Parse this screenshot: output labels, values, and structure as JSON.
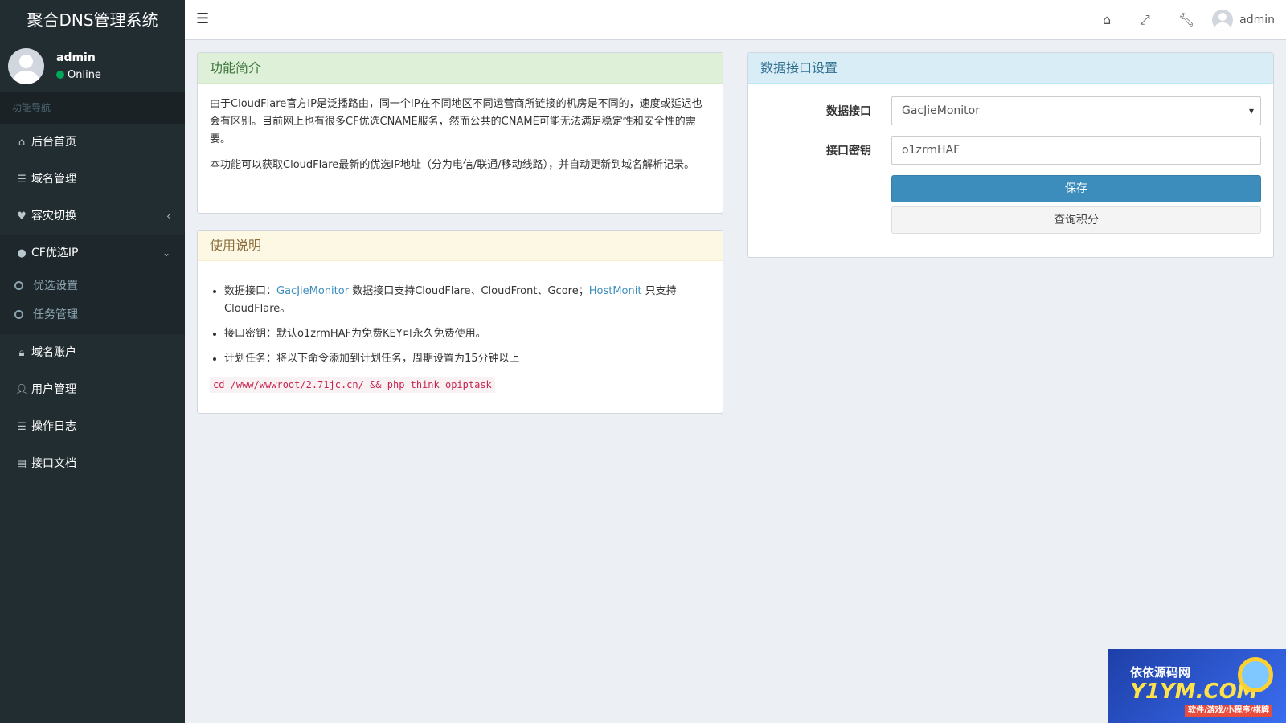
{
  "app": {
    "title": "聚合DNS管理系统"
  },
  "user": {
    "name": "admin",
    "status": "Online"
  },
  "sidebar": {
    "header": "功能导航",
    "items": [
      {
        "label": "后台首页",
        "icon": "home-icon"
      },
      {
        "label": "域名管理",
        "icon": "list-icon"
      },
      {
        "label": "容灾切换",
        "icon": "heartbeat-icon"
      },
      {
        "label": "CF优选IP",
        "icon": "globe-icon"
      },
      {
        "label": "域名账户",
        "icon": "lock-icon"
      },
      {
        "label": "用户管理",
        "icon": "user-icon"
      },
      {
        "label": "操作日志",
        "icon": "list-icon"
      },
      {
        "label": "接口文档",
        "icon": "book-icon"
      }
    ],
    "submenu": [
      {
        "label": "优选设置"
      },
      {
        "label": "任务管理"
      }
    ]
  },
  "navbar": {
    "username": "admin",
    "icons": [
      "menu-toggle-icon",
      "home-icon",
      "fullscreen-icon",
      "wrench-icon"
    ]
  },
  "intro": {
    "title": "功能简介",
    "p1": "由于CloudFlare官方IP是泛播路由，同一个IP在不同地区不同运营商所链接的机房是不同的，速度或延迟也会有区别。目前网上也有很多CF优选CNAME服务，然而公共的CNAME可能无法满足稳定性和安全性的需要。",
    "p2": "本功能可以获取CloudFlare最新的优选IP地址（分为电信/联通/移动线路），并自动更新到域名解析记录。"
  },
  "usage": {
    "title": "使用说明",
    "li1_prefix": "数据接口：",
    "li1_link1": "GacJieMonitor",
    "li1_mid": " 数据接口支持CloudFlare、CloudFront、Gcore；",
    "li1_link2": "HostMonit",
    "li1_suffix": " 只支持CloudFlare。",
    "li2": "接口密钥：默认o1zrmHAF为免费KEY可永久免费使用。",
    "li3": "计划任务：将以下命令添加到计划任务，周期设置为15分钟以上",
    "command": "cd /www/wwwroot/2.71jc.cn/ && php think opiptask"
  },
  "settings": {
    "title": "数据接口设置",
    "api_label": "数据接口",
    "api_value": "GacJieMonitor",
    "key_label": "接口密钥",
    "key_value": "o1zrmHAF",
    "save_label": "保存",
    "query_label": "查询积分"
  },
  "watermark": {
    "line1": "依依源码网",
    "line2": "Y1YM.COM",
    "line3": "软件/游戏/小程序/棋牌"
  }
}
